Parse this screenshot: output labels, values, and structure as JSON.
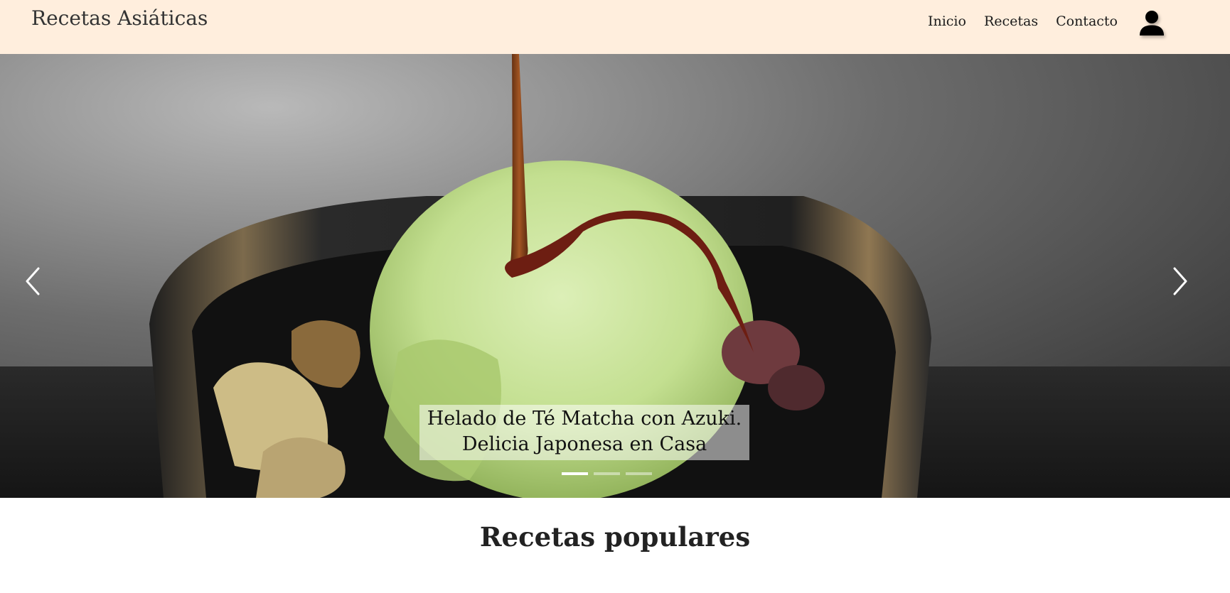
{
  "navbar": {
    "brand": "Recetas Asiáticas",
    "links": [
      {
        "label": "Inicio"
      },
      {
        "label": "Recetas"
      },
      {
        "label": "Contacto"
      }
    ],
    "user_icon": "user-icon"
  },
  "carousel": {
    "slide_caption_line1": "Helado de Té Matcha con Azuki.",
    "slide_caption_line2": "Delicia Japonesa en Casa",
    "prev_icon": "chevron-left-icon",
    "next_icon": "chevron-right-icon",
    "slide_count": 3,
    "active_slide": 1
  },
  "main": {
    "section_title": "Recetas populares"
  },
  "colors": {
    "navbar_bg": "#ffeedd",
    "caption_bg": "rgba(255,255,255,0.52)"
  }
}
